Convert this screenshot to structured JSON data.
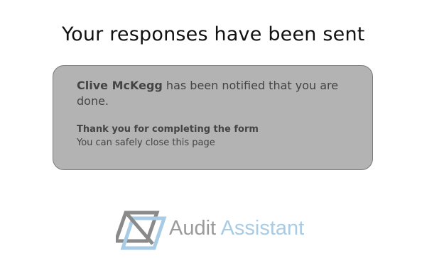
{
  "page": {
    "title": "Your responses have been sent"
  },
  "card": {
    "notifier_name": "Clive McKegg",
    "notified_text": " has been notified that you are done.",
    "thanks_title": "Thank you for completing the form",
    "thanks_subtitle": "You can safely close this page"
  },
  "brand": {
    "word1": "Audit",
    "word2": "Assistant",
    "logo_icon": "audit-assistant-logo-icon",
    "colors": {
      "word1": "#9a9a9a",
      "word2": "#a8cbe6",
      "logo_gray": "#8a8a8a",
      "logo_blue": "#a8cbe6"
    }
  },
  "colors": {
    "card_background": "#b3b3b3",
    "card_border": "#7a7a7a",
    "card_text": "#444444"
  }
}
